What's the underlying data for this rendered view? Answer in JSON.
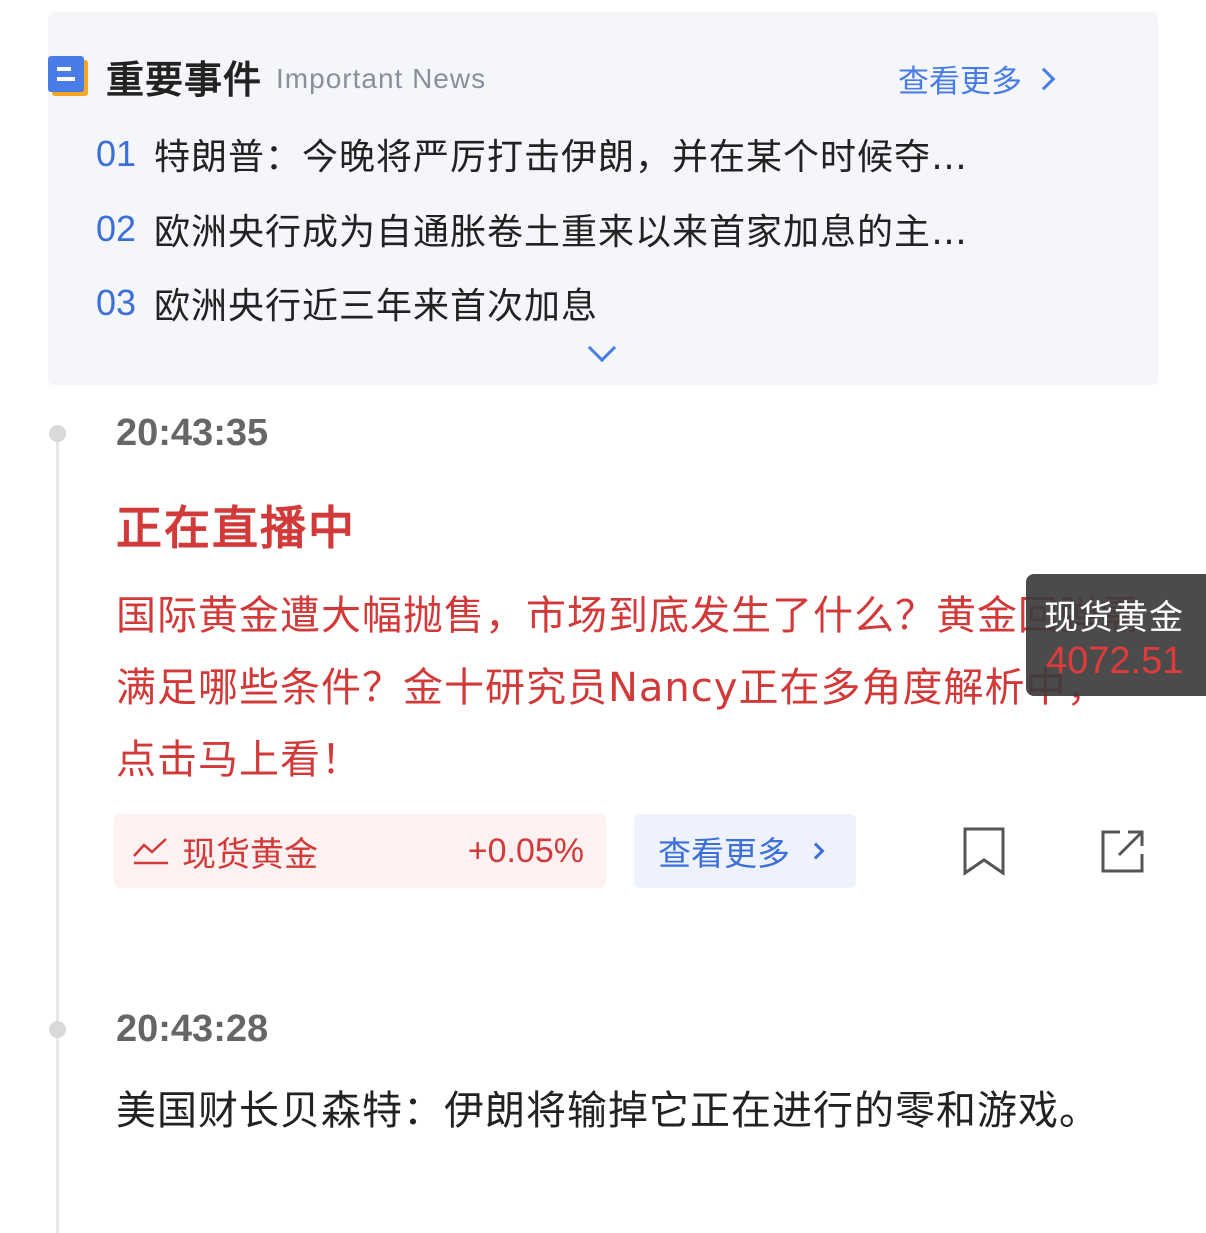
{
  "important_news": {
    "title": "重要事件",
    "subtitle": "Important News",
    "more_label": "查看更多",
    "items": [
      {
        "num": "01",
        "text": "特朗普：今晚将严厉打击伊朗，并在某个时候夺…"
      },
      {
        "num": "02",
        "text": "欧洲央行成为自通胀卷土重来以来首家加息的主…"
      },
      {
        "num": "03",
        "text": "欧洲央行近三年来首次加息"
      }
    ]
  },
  "feed": [
    {
      "time": "20:43:35",
      "title": "正在直播中",
      "body": "国际黄金遭大幅抛售，市场到底发生了什么？黄金回弹需满足哪些条件？金十研究员Nancy正在多角度解析中，点击马上看！",
      "asset_label": "现货黄金",
      "asset_change": "+0.05%",
      "more_label": "查看更多"
    },
    {
      "time": "20:43:28",
      "body": "美国财长贝森特：伊朗将输掉它正在进行的零和游戏。"
    }
  ],
  "price_widget": {
    "name": "现货黄金",
    "value": "4072.51"
  },
  "colors": {
    "accent_blue": "#4a7ce8",
    "live_red": "#d23a3a",
    "price_red": "#e03b3b"
  },
  "icons": [
    "news-icon",
    "trend-icon",
    "bookmark-icon",
    "share-icon",
    "chevron-right-icon",
    "chevron-down-icon"
  ]
}
